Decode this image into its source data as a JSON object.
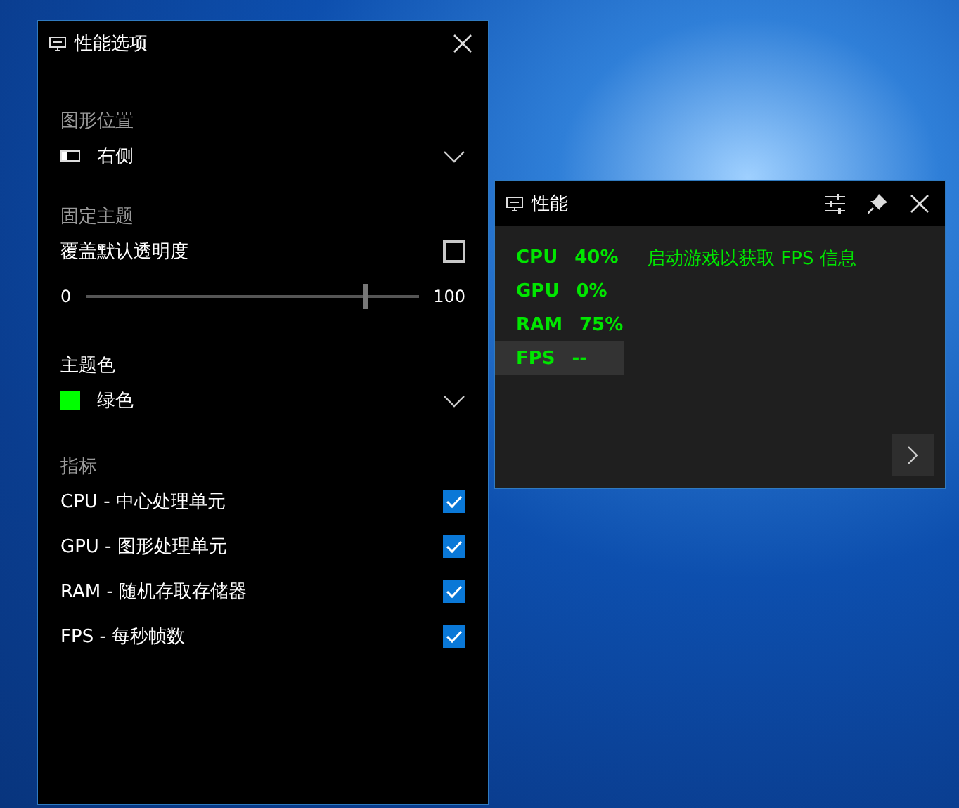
{
  "options_panel": {
    "title": "性能选项",
    "position": {
      "label": "图形位置",
      "value": "右侧"
    },
    "pinned_theme": {
      "label": "固定主题",
      "override": {
        "label": "覆盖默认透明度",
        "checked": false
      },
      "slider": {
        "min": "0",
        "max": "100",
        "level": 0.84
      }
    },
    "theme_color": {
      "label": "主题色",
      "value": "绿色",
      "color": "#00ff00"
    },
    "metrics": {
      "label": "指标",
      "items": [
        {
          "label": "CPU - 中心处理单元",
          "checked": true
        },
        {
          "label": "GPU - 图形处理单元",
          "checked": true
        },
        {
          "label": "RAM - 随机存取存储器",
          "checked": true
        },
        {
          "label": "FPS - 每秒帧数",
          "checked": true
        }
      ]
    }
  },
  "performance_widget": {
    "title": "性能",
    "metrics": [
      {
        "name": "CPU",
        "value": "40%",
        "selected": false
      },
      {
        "name": "GPU",
        "value": "0%",
        "selected": false
      },
      {
        "name": "RAM",
        "value": "75%",
        "selected": false
      },
      {
        "name": "FPS",
        "value": "--",
        "selected": true
      }
    ],
    "message": "启动游戏以获取 FPS 信息"
  }
}
